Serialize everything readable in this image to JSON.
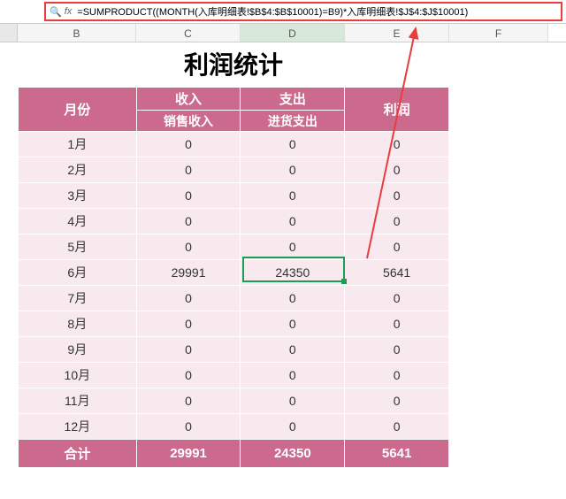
{
  "formula_bar": {
    "fx_label": "fx",
    "formula": "=SUMPRODUCT((MONTH(入库明细表!$B$4:$B$10001)=B9)*入库明细表!$J$4:$J$10001)"
  },
  "columns": [
    "B",
    "C",
    "D",
    "E",
    "F"
  ],
  "selected_column": "D",
  "title": "利润统计",
  "headers": {
    "month": "月份",
    "income": "收入",
    "expense": "支出",
    "profit": "利润",
    "income_sub": "销售收入",
    "expense_sub": "进货支出"
  },
  "rows": [
    {
      "month": "1月",
      "income": "0",
      "expense": "0",
      "profit": "0"
    },
    {
      "month": "2月",
      "income": "0",
      "expense": "0",
      "profit": "0"
    },
    {
      "month": "3月",
      "income": "0",
      "expense": "0",
      "profit": "0"
    },
    {
      "month": "4月",
      "income": "0",
      "expense": "0",
      "profit": "0"
    },
    {
      "month": "5月",
      "income": "0",
      "expense": "0",
      "profit": "0"
    },
    {
      "month": "6月",
      "income": "29991",
      "expense": "24350",
      "profit": "5641"
    },
    {
      "month": "7月",
      "income": "0",
      "expense": "0",
      "profit": "0"
    },
    {
      "month": "8月",
      "income": "0",
      "expense": "0",
      "profit": "0"
    },
    {
      "month": "9月",
      "income": "0",
      "expense": "0",
      "profit": "0"
    },
    {
      "month": "10月",
      "income": "0",
      "expense": "0",
      "profit": "0"
    },
    {
      "month": "11月",
      "income": "0",
      "expense": "0",
      "profit": "0"
    },
    {
      "month": "12月",
      "income": "0",
      "expense": "0",
      "profit": "0"
    }
  ],
  "totals": {
    "label": "合计",
    "income": "29991",
    "expense": "24350",
    "profit": "5641"
  },
  "active_cell": {
    "col": "D",
    "row_index": 5
  },
  "chart_data": {
    "type": "table",
    "title": "利润统计",
    "columns": [
      "月份",
      "销售收入",
      "进货支出",
      "利润"
    ],
    "rows": [
      [
        "1月",
        0,
        0,
        0
      ],
      [
        "2月",
        0,
        0,
        0
      ],
      [
        "3月",
        0,
        0,
        0
      ],
      [
        "4月",
        0,
        0,
        0
      ],
      [
        "5月",
        0,
        0,
        0
      ],
      [
        "6月",
        29991,
        24350,
        5641
      ],
      [
        "7月",
        0,
        0,
        0
      ],
      [
        "8月",
        0,
        0,
        0
      ],
      [
        "9月",
        0,
        0,
        0
      ],
      [
        "10月",
        0,
        0,
        0
      ],
      [
        "11月",
        0,
        0,
        0
      ],
      [
        "12月",
        0,
        0,
        0
      ],
      [
        "合计",
        29991,
        24350,
        5641
      ]
    ]
  }
}
